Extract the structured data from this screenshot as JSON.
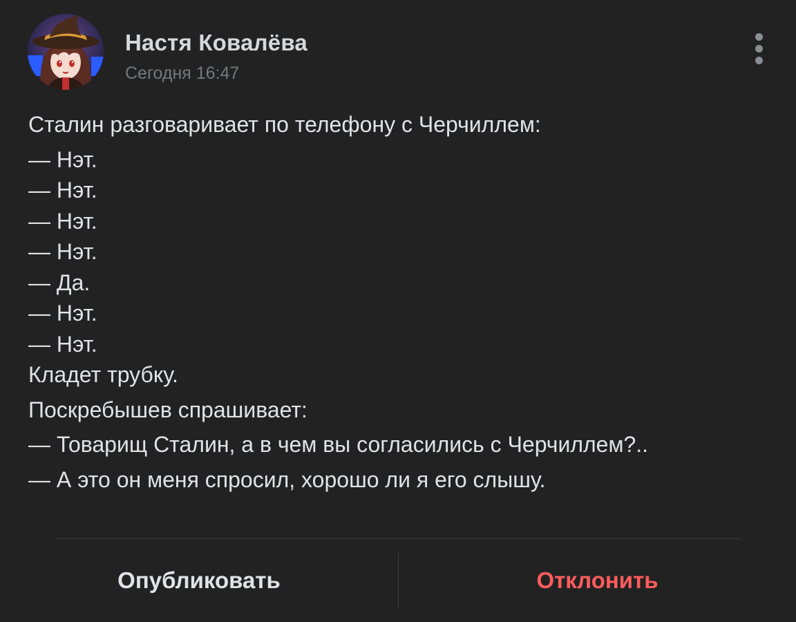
{
  "author": {
    "name": "Настя Ковалёва",
    "time": "Сегодня 16:47",
    "avatar_icon": "avatar-anime-girl-witch-hat"
  },
  "menu": {
    "icon": "more-vertical-icon"
  },
  "post": {
    "lines": [
      "Сталин разговаривает по телефону с Черчиллем:",
      "— Нэт.",
      "— Нэт.",
      "— Нэт.",
      "— Нэт.",
      "— Да.",
      "— Нэт.",
      "— Нэт.",
      "Кладет трубку.",
      "Поскребышев спрашивает:",
      "— Товарищ Сталин, а в чем вы согласились с Черчиллем?..",
      "— А это он меня спросил, хорошо ли я его слышу."
    ]
  },
  "actions": {
    "publish_label": "Опубликовать",
    "decline_label": "Отклонить",
    "decline_color": "#ff5c5c"
  },
  "colors": {
    "background": "#222223",
    "text": "#e1e3e6",
    "secondary": "#75787d"
  }
}
